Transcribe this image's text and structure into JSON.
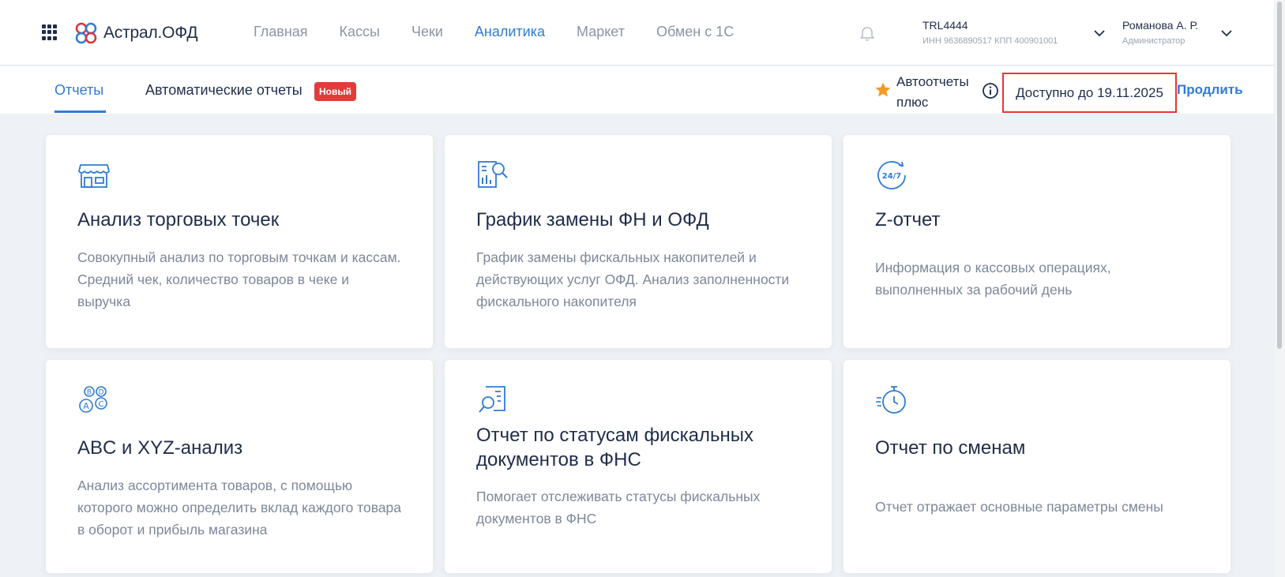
{
  "header": {
    "logo_text": "Астрал.ОФД",
    "nav": [
      {
        "label": "Главная"
      },
      {
        "label": "Кассы"
      },
      {
        "label": "Чеки"
      },
      {
        "label": "Аналитика"
      },
      {
        "label": "Маркет"
      },
      {
        "label": "Обмен с 1С"
      }
    ],
    "active_nav": "Аналитика",
    "org": {
      "name": "TRL4444",
      "details": "ИНН 9636890517  КПП 400901001"
    },
    "user": {
      "name": "Романова А. Р.",
      "role": "Администратор"
    }
  },
  "subheader": {
    "tabs": [
      {
        "label": "Отчеты"
      },
      {
        "label": "Автоматические отчеты"
      }
    ],
    "active_tab": "Отчеты",
    "new_badge": "Новый",
    "autoreports_label": "Автоотчеты плюс",
    "availability": "Доступно до 19.11.2025",
    "extend_label": "Продлить"
  },
  "cards": [
    {
      "icon": "store-icon",
      "title": "Анализ торговых точек",
      "desc": "Совокупный анализ по торговым точкам и кассам. Средний чек, количество товаров в чеке и выручка"
    },
    {
      "icon": "report-search-icon",
      "title": "График замены ФН и ОФД",
      "desc": "График замены фискальных накопителей и действующих услуг ОФД. Анализ заполненности фискального накопителя"
    },
    {
      "icon": "clock-24-7-icon",
      "title": "Z-отчет",
      "desc": "Информация о кассовых операциях, выполненных за рабочий день"
    },
    {
      "icon": "abcd-circles-icon",
      "title": "ABC и XYZ-анализ",
      "desc": "Анализ ассортимента товаров, с помощью которого можно определить вклад каждого товара в оборот и прибыль магазина"
    },
    {
      "icon": "document-search-icon",
      "title": "Отчет по статусам фискальных документов в ФНС",
      "desc": "Помогает отслеживать статусы фискальных документов в ФНС"
    },
    {
      "icon": "stopwatch-icon",
      "title": "Отчет по сменам",
      "desc": "Отчет отражает основные параметры смены"
    }
  ],
  "colors": {
    "accent": "#2f7bd6",
    "highlight_border": "#e53535",
    "badge": "#e23b3b",
    "star": "#f29b2a"
  }
}
